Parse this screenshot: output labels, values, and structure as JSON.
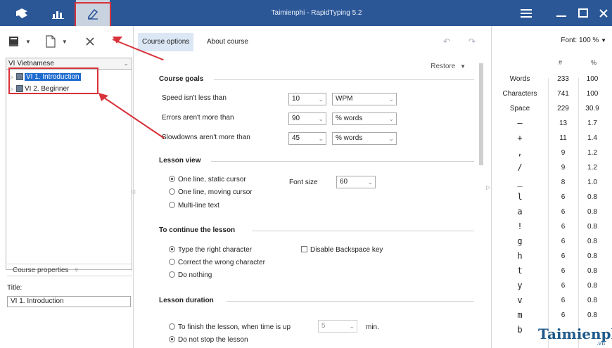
{
  "window": {
    "title": "Taimienphi - RapidTyping 5.2"
  },
  "toolbar": {
    "icons": [
      "keyboard-icon",
      "statistics-icon",
      "editor-icon"
    ],
    "menu_icon": "hamburger-icon",
    "minimize": "minimize-icon",
    "maximize": "maximize-icon",
    "close": "close-icon"
  },
  "left": {
    "toolbar_icons": [
      "course-icon",
      "new-file-icon",
      "delete-icon"
    ],
    "course_select": "VI Vietnamese",
    "tree": [
      {
        "label": "VI 1. Introduction",
        "selected": true
      },
      {
        "label": "VI 2. Beginner",
        "selected": false
      }
    ],
    "properties_label": "Course properties",
    "title_label": "Title:",
    "title_value": "VI 1. Introduction"
  },
  "tabs": [
    "Course options",
    "About course"
  ],
  "main": {
    "restore": "Restore",
    "course_goals": {
      "heading": "Course goals",
      "rows": [
        {
          "label": "Speed isn't less than",
          "value": "10",
          "unit": "WPM"
        },
        {
          "label": "Errors aren't more than",
          "value": "90",
          "unit": "% words"
        },
        {
          "label": "Slowdowns aren't more than",
          "value": "45",
          "unit": "% words"
        }
      ]
    },
    "lesson_view": {
      "heading": "Lesson view",
      "options": [
        "One line, static cursor",
        "One line, moving cursor",
        "Multi-line text"
      ],
      "selected": 0,
      "font_size_label": "Font size",
      "font_size_value": "60"
    },
    "continue": {
      "heading": "To continue the lesson",
      "options": [
        "Type the right character",
        "Correct the wrong character",
        "Do nothing"
      ],
      "selected": 0,
      "disable_backspace": "Disable Backspace key"
    },
    "duration": {
      "heading": "Lesson duration",
      "options": [
        "To finish the lesson, when time is up",
        "Do not stop the lesson"
      ],
      "selected": 1,
      "time_value": "5",
      "time_unit": "min."
    }
  },
  "right": {
    "font_label": "Font: 100 %",
    "headers": [
      "#",
      "%"
    ],
    "rows": [
      {
        "k": "Words",
        "n": "233",
        "p": "100"
      },
      {
        "k": "Characters",
        "n": "741",
        "p": "100"
      },
      {
        "k": "Space",
        "n": "229",
        "p": "30.9"
      },
      {
        "k": "–",
        "n": "13",
        "p": "1.7"
      },
      {
        "k": "+",
        "n": "11",
        "p": "1.4"
      },
      {
        "k": ",",
        "n": "9",
        "p": "1.2"
      },
      {
        "k": "/",
        "n": "9",
        "p": "1.2"
      },
      {
        "k": "_",
        "n": "8",
        "p": "1.0"
      },
      {
        "k": "l",
        "n": "6",
        "p": "0.8"
      },
      {
        "k": "a",
        "n": "6",
        "p": "0.8"
      },
      {
        "k": "!",
        "n": "6",
        "p": "0.8"
      },
      {
        "k": "g",
        "n": "6",
        "p": "0.8"
      },
      {
        "k": "h",
        "n": "6",
        "p": "0.8"
      },
      {
        "k": "t",
        "n": "6",
        "p": "0.8"
      },
      {
        "k": "y",
        "n": "6",
        "p": "0.8"
      },
      {
        "k": "v",
        "n": "6",
        "p": "0.8"
      },
      {
        "k": "m",
        "n": "6",
        "p": "0.8"
      },
      {
        "k": "b",
        "n": "",
        "p": ""
      }
    ]
  },
  "watermark": "Taimienphi",
  "watermark_suffix": ".vn",
  "accent": "#2b5797",
  "highlight": "#d9323a"
}
